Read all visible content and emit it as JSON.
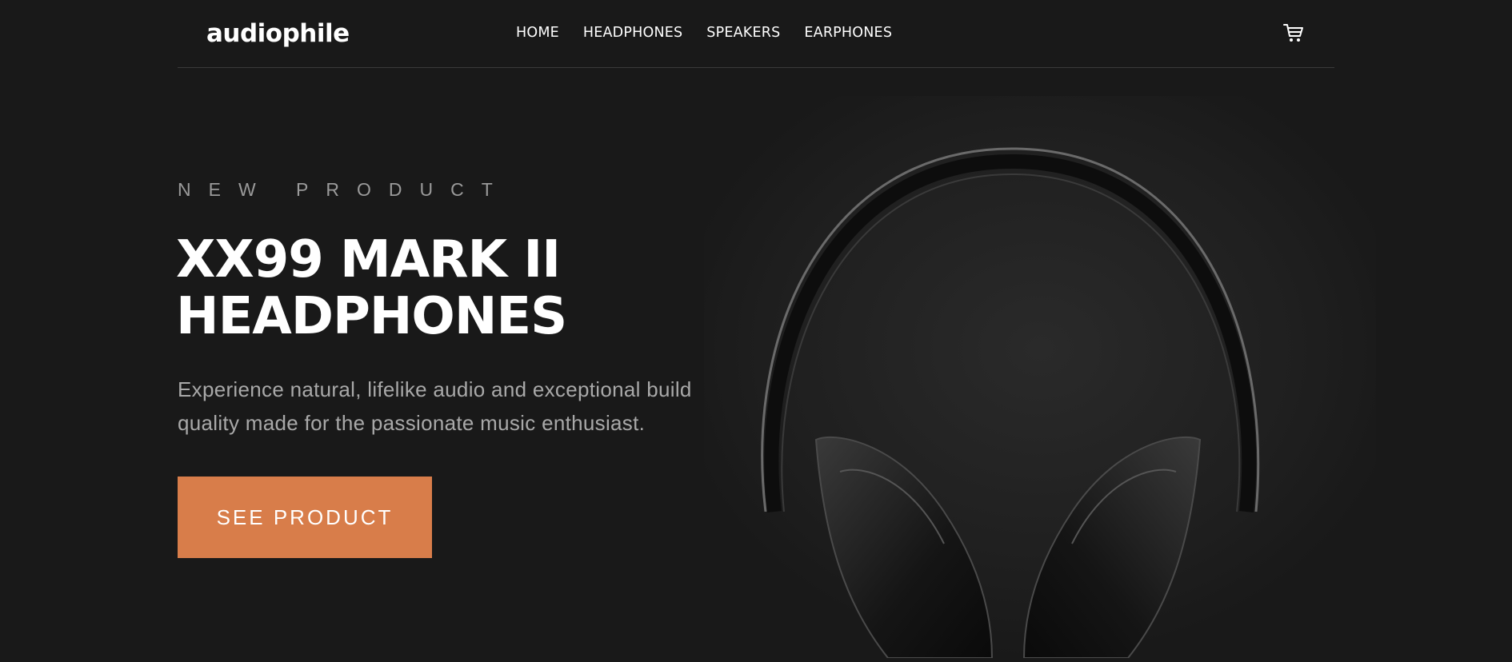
{
  "header": {
    "logo": "audiophile",
    "nav": [
      "HOME",
      "HEADPHONES",
      "SPEAKERS",
      "EARPHONES"
    ],
    "cart_icon": "cart-icon"
  },
  "hero": {
    "overline": "NEW PRODUCT",
    "title_line1": "XX99 MARK II",
    "title_line2": "HEADPHONES",
    "description": "Experience natural, lifelike audio and exceptional build quality made for the passionate music enthusiast.",
    "cta": "SEE PRODUCT",
    "image": "headphones-photo"
  },
  "colors": {
    "background": "#191919",
    "accent": "#d87d4a",
    "muted_text": "#a9a9a9"
  }
}
